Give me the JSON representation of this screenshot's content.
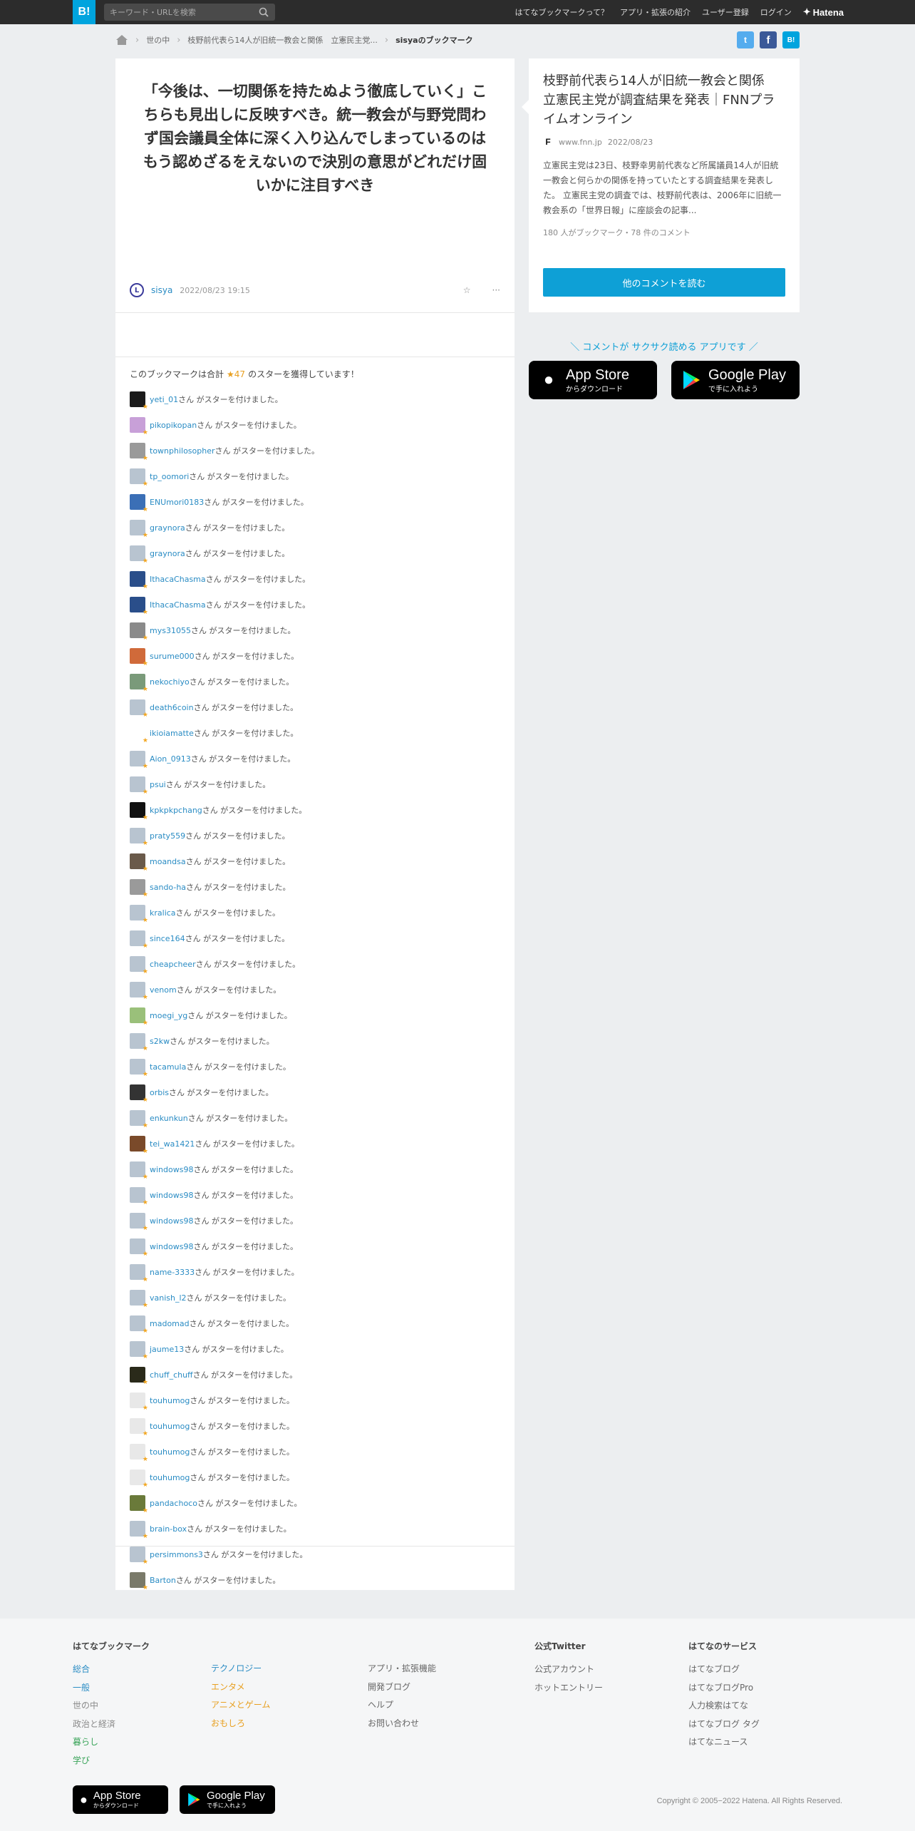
{
  "topbar": {
    "logo": "B!",
    "search_placeholder": "キーワード・URLを検索",
    "nav": [
      "はてなブックマークって？",
      "アプリ・拡張の紹介",
      "ユーザー登録",
      "ログイン"
    ],
    "brand": "Hatena"
  },
  "breadcrumb": {
    "items": [
      "世の中",
      "枝野前代表ら14人が旧統一教会と関係　立憲民主党..."
    ],
    "current": "sisyaのブックマーク"
  },
  "share": {
    "twitter": "t",
    "facebook": "f",
    "hatena": "B!"
  },
  "comment": {
    "text": "「今後は、一切関係を持たぬよう徹底していく」こちらも見出しに反映すべき。統一教会が与野党問わず国会議員全体に深く入り込んでしまっているのはもう認めざるをえないので決別の意思がどれだけ固いかに注目すべき",
    "user": "sisya",
    "date": "2022/08/23 19:15",
    "star_icon": "☆",
    "menu_icon": "···"
  },
  "summary": {
    "prefix": "このブックマークは合計",
    "star": "★",
    "count": "47",
    "suffix": "のスターを獲得しています！"
  },
  "star_suffix": "さん がスターを付けました。",
  "stars": [
    {
      "name": "yeti_01",
      "color": "#1b1b1b"
    },
    {
      "name": "pikopikopan",
      "color": "#c8a0d8"
    },
    {
      "name": "townphilosopher",
      "color": "#9a9a9a"
    },
    {
      "name": "tp_oomori",
      "color": "#b8c4d0"
    },
    {
      "name": "ENUmori0183",
      "color": "#3b6fb6"
    },
    {
      "name": "graynora",
      "color": "#b8c4d0"
    },
    {
      "name": "graynora",
      "color": "#b8c4d0"
    },
    {
      "name": "IthacaChasma",
      "color": "#2a4e8a"
    },
    {
      "name": "IthacaChasma",
      "color": "#2a4e8a"
    },
    {
      "name": "mys31055",
      "color": "#8a8a8a"
    },
    {
      "name": "surume000",
      "color": "#d06a3a"
    },
    {
      "name": "nekochiyo",
      "color": "#7a9a7a"
    },
    {
      "name": "death6coin",
      "color": "#b8c4d0"
    },
    {
      "name": "ikioiamatte",
      "color": "#ffffff"
    },
    {
      "name": "Aion_0913",
      "color": "#b8c4d0"
    },
    {
      "name": "psui",
      "color": "#b8c4d0"
    },
    {
      "name": "kpkpkpchang",
      "color": "#111111"
    },
    {
      "name": "praty559",
      "color": "#b8c4d0"
    },
    {
      "name": "moandsa",
      "color": "#6a5a4a"
    },
    {
      "name": "sando-ha",
      "color": "#9a9a9a"
    },
    {
      "name": "kralica",
      "color": "#b8c4d0"
    },
    {
      "name": "since164",
      "color": "#b8c4d0"
    },
    {
      "name": "cheapcheer",
      "color": "#b8c4d0"
    },
    {
      "name": "venom",
      "color": "#b8c4d0"
    },
    {
      "name": "moegi_yg",
      "color": "#9ac07a"
    },
    {
      "name": "s2kw",
      "color": "#b8c4d0"
    },
    {
      "name": "tacamula",
      "color": "#b8c4d0"
    },
    {
      "name": "orbis",
      "color": "#333333"
    },
    {
      "name": "enkunkun",
      "color": "#b8c4d0"
    },
    {
      "name": "tei_wa1421",
      "color": "#7a4a2a"
    },
    {
      "name": "windows98",
      "color": "#b8c4d0"
    },
    {
      "name": "windows98",
      "color": "#b8c4d0"
    },
    {
      "name": "windows98",
      "color": "#b8c4d0"
    },
    {
      "name": "windows98",
      "color": "#b8c4d0"
    },
    {
      "name": "name-3333",
      "color": "#b8c4d0"
    },
    {
      "name": "vanish_l2",
      "color": "#b8c4d0"
    },
    {
      "name": "madomad",
      "color": "#b8c4d0"
    },
    {
      "name": "jaume13",
      "color": "#b8c4d0"
    },
    {
      "name": "chuff_chuff",
      "color": "#2a2a1a"
    },
    {
      "name": "touhumog",
      "color": "#e8e8e8"
    },
    {
      "name": "touhumog",
      "color": "#e8e8e8"
    },
    {
      "name": "touhumog",
      "color": "#e8e8e8"
    },
    {
      "name": "touhumog",
      "color": "#e8e8e8"
    },
    {
      "name": "pandachoco",
      "color": "#6a7a3a"
    },
    {
      "name": "brain-box",
      "color": "#b8c4d0"
    },
    {
      "name": "persimmons3",
      "color": "#b8c4d0"
    },
    {
      "name": "Barton",
      "color": "#7a7a6a"
    }
  ],
  "entry": {
    "title": "枝野前代表ら14人が旧統一教会と関係　立憲民主党が調査結果を発表｜FNNプライムオンライン",
    "favicon": "F",
    "domain": "www.fnn.jp",
    "date": "2022/08/23",
    "description": "立憲民主党は23日、枝野幸男前代表など所属議員14人が旧統一教会と何らかの関係を持っていたとする調査結果を発表した。 立憲民主党の調査では、枝野前代表は、2006年に旧統一教会系の「世界日報」に座談会の記事...",
    "stats": "180 人がブックマーク・78 件のコメント",
    "more_button": "他のコメントを読む"
  },
  "promo": {
    "text": "＼ コメントが サクサク読める アプリです ／",
    "appstore_big": "App Store",
    "appstore_small": "からダウンロード",
    "googleplay_big": "Google Play",
    "googleplay_small": "で手に入れよう"
  },
  "footer": {
    "col1_title": "はてなブックマーク",
    "col1a": [
      {
        "label": "総合",
        "color": "#2a8cc4"
      },
      {
        "label": "一般",
        "color": "#2a8cc4"
      },
      {
        "label": "世の中",
        "color": "#8a8a8a"
      },
      {
        "label": "政治と経済",
        "color": "#8a8a8a"
      },
      {
        "label": "暮らし",
        "color": "#3aa45a"
      },
      {
        "label": "学び",
        "color": "#3aa45a"
      }
    ],
    "col1b": [
      {
        "label": "テクノロジー",
        "color": "#2a8cc4"
      },
      {
        "label": "エンタメ",
        "color": "#e8a021"
      },
      {
        "label": "アニメとゲーム",
        "color": "#e8a021"
      },
      {
        "label": "おもしろ",
        "color": "#e8a021"
      }
    ],
    "col2": [
      "アプリ・拡張機能",
      "開発ブログ",
      "ヘルプ",
      "お問い合わせ"
    ],
    "col3_title": "公式Twitter",
    "col3": [
      "公式アカウント",
      "ホットエントリー"
    ],
    "col4_title": "はてなのサービス",
    "col4": [
      "はてなブログ",
      "はてなブログPro",
      "人力検索はてな",
      "はてなブログ タグ",
      "はてなニュース"
    ],
    "copyright": "Copyright © 2005−2022 Hatena. All Rights Reserved."
  }
}
